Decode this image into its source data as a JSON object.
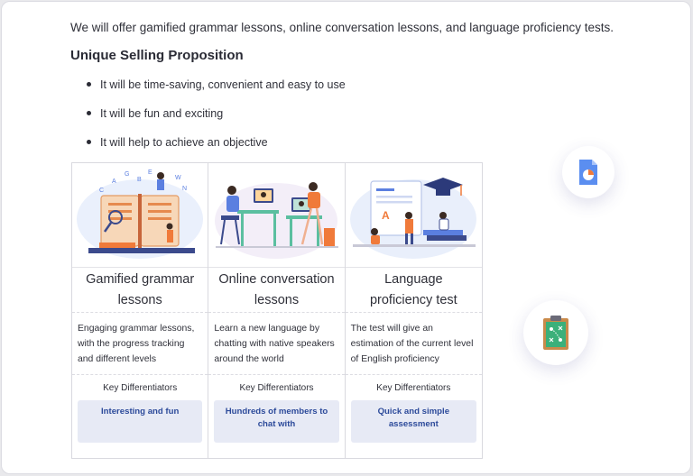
{
  "intro": "We will offer gamified grammar lessons, online conversation lessons, and language proficiency tests.",
  "usp_title": "Unique Selling Proposition",
  "bullets": [
    "It will be time-saving, convenient and easy to use",
    "It will be fun and exciting",
    "It will help to achieve an objective"
  ],
  "columns": [
    {
      "title_line1": "Gamified grammar",
      "title_line2": "lessons",
      "desc": [
        "Engaging grammar lessons,",
        "with the progress tracking",
        "and different levels"
      ],
      "kd_label": "Key Differentiators",
      "kd_value": [
        "Interesting and fun",
        ""
      ]
    },
    {
      "title_line1": "Online conversation",
      "title_line2": "lessons",
      "desc": [
        "Learn a new language by",
        "chatting with native speakers",
        "around the world"
      ],
      "kd_label": "Key Differentiators",
      "kd_value": [
        "Hundreds of members to",
        "chat with"
      ]
    },
    {
      "title_line1": "Language",
      "title_line2": "proficiency test",
      "desc": [
        "The test will give an",
        "estimation of the current level",
        "of English proficiency"
      ],
      "kd_label": "Key Differentiators",
      "kd_value": [
        "Quick and simple",
        "assessment"
      ]
    }
  ],
  "illus_letters": [
    "A",
    "G",
    "B",
    "W",
    "N",
    "C",
    "E"
  ],
  "illus_test_letter": "A",
  "icons": {
    "float_top": "document-pie-chart-icon",
    "float_bottom": "clipboard-strategy-icon"
  },
  "colors": {
    "accent_blue": "#2c4a9a",
    "box_bg": "#e7eaf5",
    "illus_blue": "#5b7fe0",
    "illus_orange": "#f07a3a"
  }
}
